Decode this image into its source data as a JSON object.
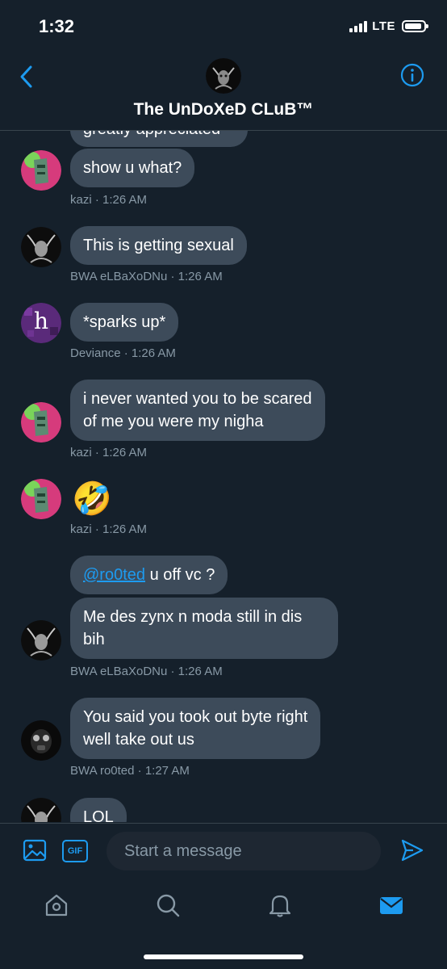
{
  "status_bar": {
    "time": "1:32",
    "network": "LTE"
  },
  "header": {
    "title": "The UnDoXeD CLuB™"
  },
  "messages": [
    {
      "text": "greatly appreciated"
    },
    {
      "text": "show u what?",
      "meta": "kazi · 1:26 AM"
    },
    {
      "text": "This is getting sexual",
      "meta": "BWA eLBaXoDNu · 1:26 AM"
    },
    {
      "text": "*sparks up*",
      "meta": "Deviance · 1:26 AM",
      "avatar_letter": "h"
    },
    {
      "line1": "i never wanted you to be scared",
      "line2": "of me you were my nigha",
      "meta": "kazi · 1:26 AM"
    },
    {
      "emoji": "🤣",
      "meta": "kazi · 1:26 AM"
    },
    {
      "mention": "@ro0ted",
      "rest": " u off vc ?"
    },
    {
      "line1": "Me des zynx n moda still in dis",
      "line2": "bih",
      "meta": "BWA eLBaXoDNu · 1:26 AM"
    },
    {
      "line1": "You said you took out byte right",
      "line2": "well take out us",
      "meta": "BWA ro0ted · 1:27 AM"
    },
    {
      "text": "LOL"
    }
  ],
  "composer": {
    "placeholder": "Start a message",
    "gif_label": "GIF"
  },
  "icons": {
    "back": "chevron-left-icon",
    "info": "info-icon",
    "image": "image-icon",
    "send": "send-icon",
    "home": "home-icon",
    "search": "search-icon",
    "notifications": "bell-icon",
    "messages": "mail-icon"
  },
  "colors": {
    "background": "#15202b",
    "bubble": "#3d4b5a",
    "accent": "#1d9bf0",
    "meta": "#8899a6"
  }
}
